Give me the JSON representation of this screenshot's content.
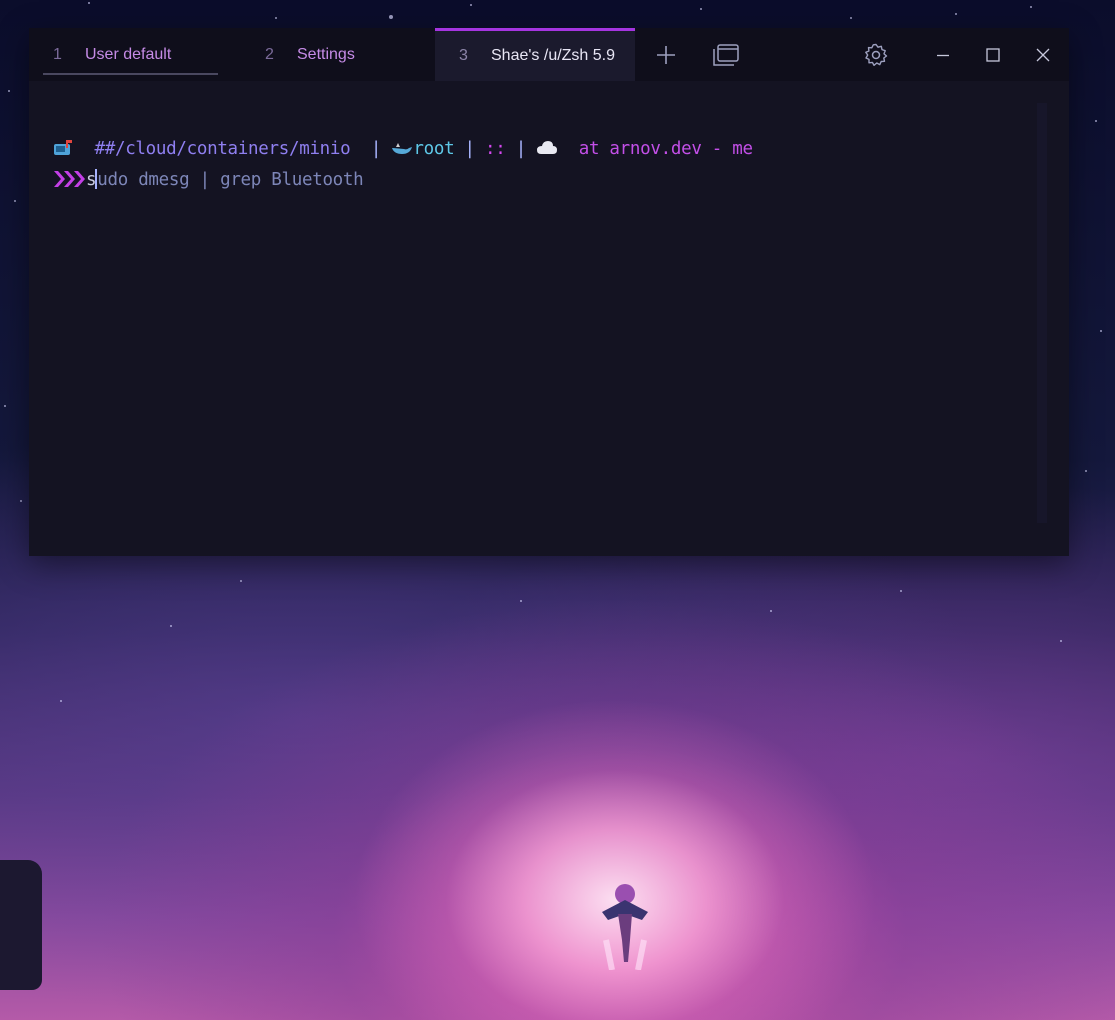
{
  "tabs": [
    {
      "number": "1",
      "label": "User default"
    },
    {
      "number": "2",
      "label": "Settings"
    },
    {
      "number": "3",
      "label": "Shae's /u/Zsh 5.9"
    }
  ],
  "colors": {
    "accent": "#a535e0",
    "tab_label": "#c58be6",
    "terminal_bg": "#141322",
    "prompt_path": "#8f7ff0",
    "prompt_cyan": "#5ec8e8",
    "prompt_pink": "#d447f0"
  },
  "icons": [
    "new-tab-plus-icon",
    "tab-overview-icon",
    "gear-icon",
    "minimize-icon",
    "maximize-icon",
    "close-icon",
    "mailbox-icon",
    "whale-icon",
    "cloud-icon",
    "prompt-chevrons-icon"
  ],
  "prompt": {
    "path": "##/cloud/containers/minio",
    "sep1": " | ",
    "user": "root",
    "sep2": " | ",
    "colons": "::",
    "sep3": " | ",
    "at_host": "at arnov.dev",
    "dash": " - ",
    "context": "me"
  },
  "command": {
    "first_char": "s",
    "rest": "udo dmesg | grep Bluetooth"
  }
}
